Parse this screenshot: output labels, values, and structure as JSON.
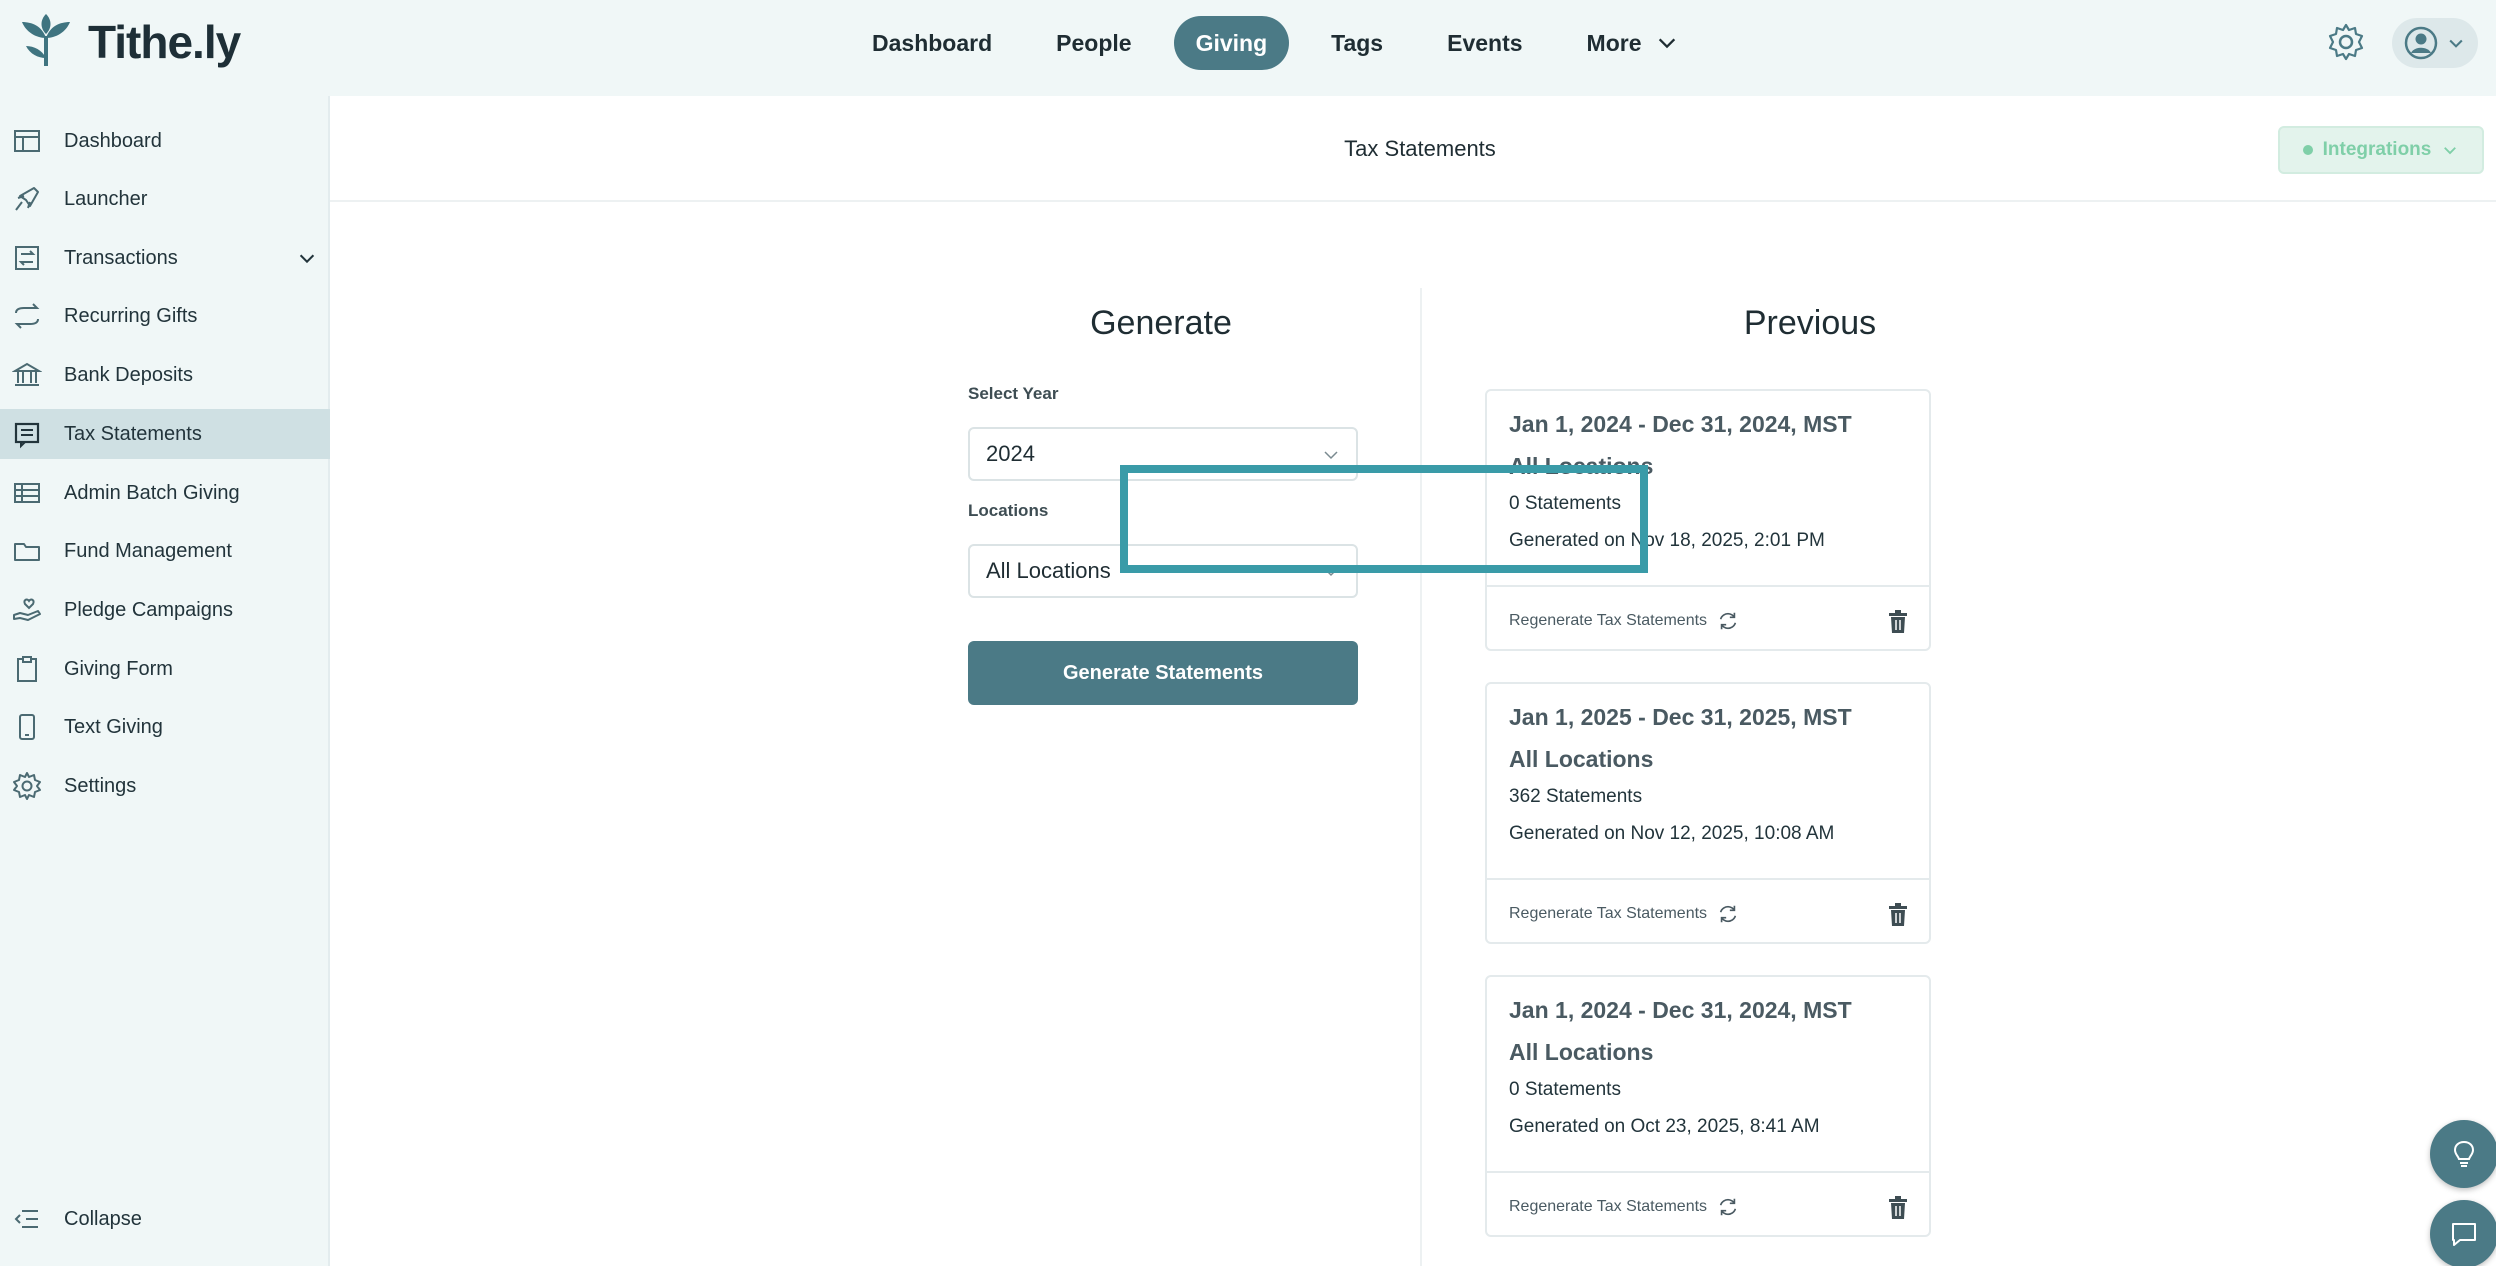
{
  "app": {
    "name": "Tithe.ly"
  },
  "topnav": {
    "items": [
      {
        "label": "Dashboard",
        "active": false
      },
      {
        "label": "People",
        "active": false
      },
      {
        "label": "Giving",
        "active": true
      },
      {
        "label": "Tags",
        "active": false
      },
      {
        "label": "Events",
        "active": false
      },
      {
        "label": "More",
        "active": false
      }
    ]
  },
  "sidebar": {
    "items": [
      {
        "label": "Dashboard",
        "icon": "dashboard-icon"
      },
      {
        "label": "Launcher",
        "icon": "plane-icon"
      },
      {
        "label": "Transactions",
        "icon": "transactions-icon",
        "expandable": true
      },
      {
        "label": "Recurring Gifts",
        "icon": "recurring-icon"
      },
      {
        "label": "Bank Deposits",
        "icon": "bank-icon"
      },
      {
        "label": "Tax Statements",
        "icon": "statement-icon",
        "active": true
      },
      {
        "label": "Admin Batch Giving",
        "icon": "batch-icon"
      },
      {
        "label": "Fund Management",
        "icon": "folder-icon"
      },
      {
        "label": "Pledge Campaigns",
        "icon": "pledge-icon"
      },
      {
        "label": "Giving Form",
        "icon": "clipboard-icon"
      },
      {
        "label": "Text Giving",
        "icon": "phone-icon"
      },
      {
        "label": "Settings",
        "icon": "gear-icon"
      }
    ],
    "collapse_label": "Collapse"
  },
  "page": {
    "title": "Tax Statements",
    "integrations_label": "Integrations"
  },
  "generate": {
    "title": "Generate",
    "year_label": "Select Year",
    "year_value": "2024",
    "locations_label": "Locations",
    "locations_value": "All Locations",
    "button_label": "Generate Statements"
  },
  "previous": {
    "title": "Previous",
    "regenerate_label": "Regenerate Tax Statements",
    "cards": [
      {
        "range": "Jan 1, 2024 - Dec 31, 2024, MST",
        "location": "All Locations",
        "count": "0 Statements",
        "generated": "Generated on Nov 18, 2025, 2:01 PM"
      },
      {
        "range": "Jan 1, 2025 - Dec 31, 2025, MST",
        "location": "All Locations",
        "count": "362 Statements",
        "generated": "Generated on Nov 12, 2025, 10:08 AM"
      },
      {
        "range": "Jan 1, 2024 - Dec 31, 2024, MST",
        "location": "All Locations",
        "count": "0 Statements",
        "generated": "Generated on Oct 23, 2025, 8:41 AM"
      }
    ]
  },
  "colors": {
    "primary": "#4b7a86",
    "highlight": "#3a9ba8",
    "integrations": "#7fcfa8",
    "sidebar_active": "#cfe0e3"
  }
}
